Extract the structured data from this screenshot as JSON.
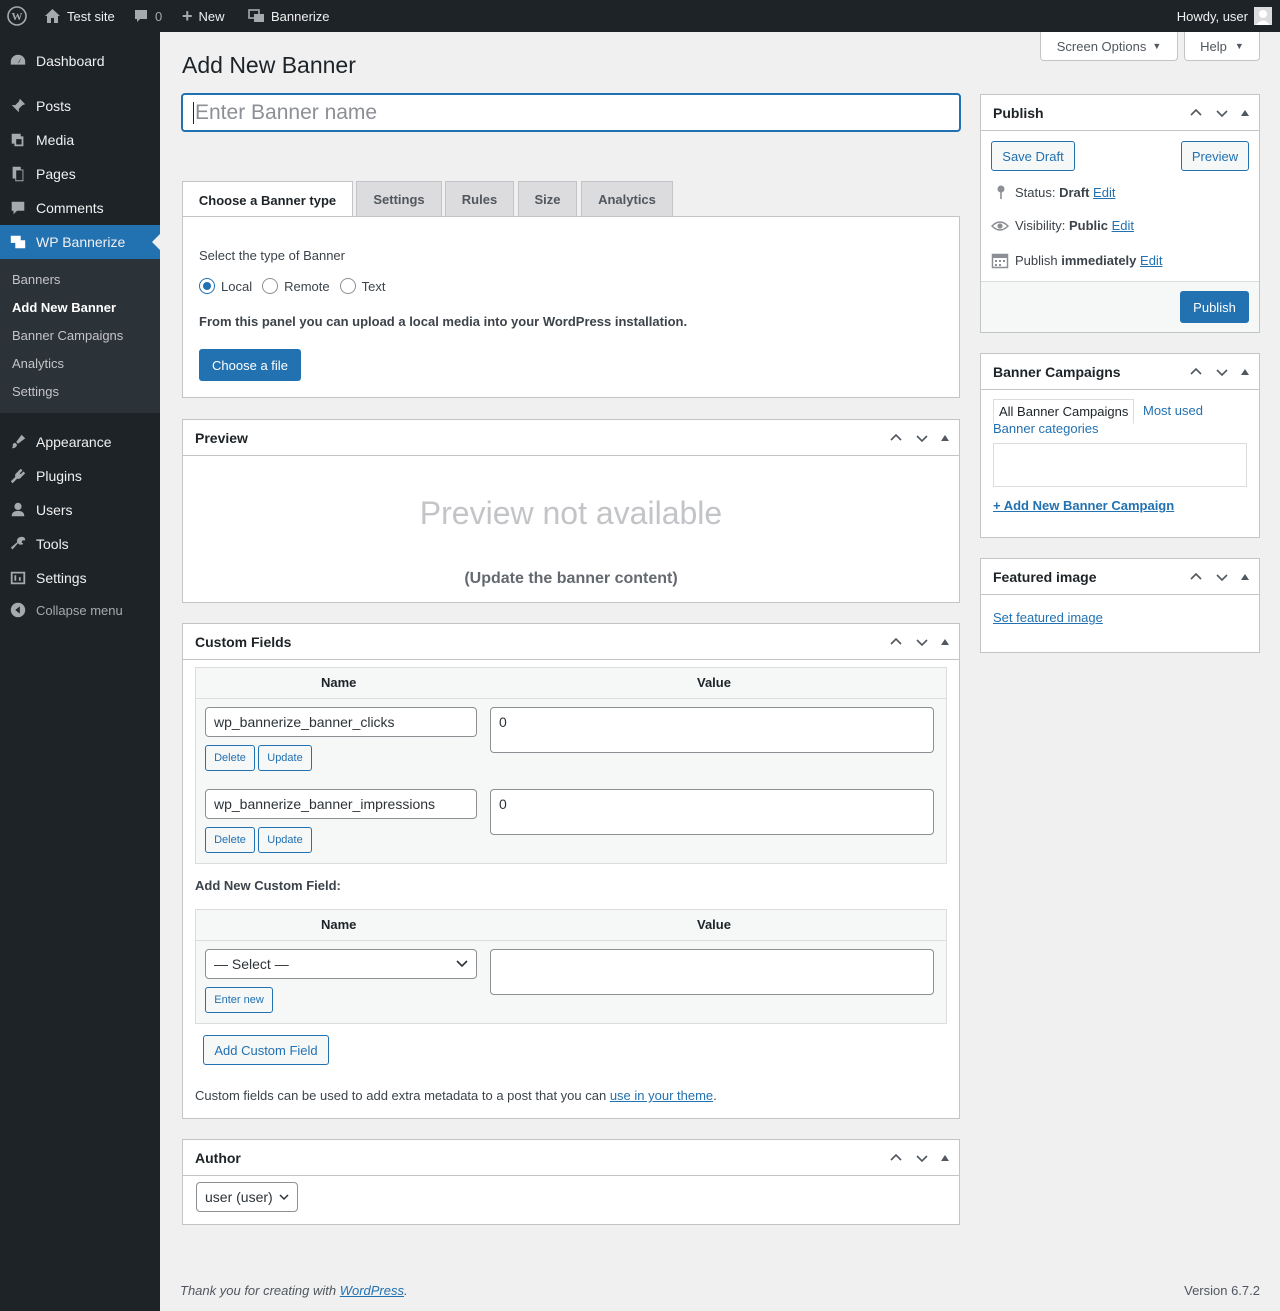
{
  "adminbar": {
    "site": "Test site",
    "comments": "0",
    "new": "New",
    "plugin": "Bannerize",
    "howdy": "Howdy, user"
  },
  "menu": {
    "items": [
      {
        "label": "Dashboard",
        "icon": "dashboard-icon"
      },
      {
        "label": "Posts",
        "icon": "pin-icon"
      },
      {
        "label": "Media",
        "icon": "media-icon"
      },
      {
        "label": "Pages",
        "icon": "pages-icon"
      },
      {
        "label": "Comments",
        "icon": "comment-icon"
      },
      {
        "label": "WP Bannerize",
        "icon": "bannerize-icon"
      },
      {
        "label": "Appearance",
        "icon": "brush-icon"
      },
      {
        "label": "Plugins",
        "icon": "plug-icon"
      },
      {
        "label": "Users",
        "icon": "user-icon"
      },
      {
        "label": "Tools",
        "icon": "wrench-icon"
      },
      {
        "label": "Settings",
        "icon": "settings-icon"
      }
    ],
    "submenu": [
      "Banners",
      "Add New Banner",
      "Banner Campaigns",
      "Analytics",
      "Settings"
    ],
    "collapse": "Collapse menu"
  },
  "top": {
    "screen_options": "Screen Options",
    "help": "Help"
  },
  "page": {
    "title": "Add New Banner",
    "name_placeholder": "Enter Banner name"
  },
  "tabs": [
    "Choose a Banner type",
    "Settings",
    "Rules",
    "Size",
    "Analytics"
  ],
  "bannertype": {
    "prompt": "Select the type of Banner",
    "options": [
      "Local",
      "Remote",
      "Text"
    ],
    "selected": "Local",
    "info": "From this panel you can upload a local media into your WordPress installation.",
    "choose_file": "Choose a file"
  },
  "preview": {
    "title": "Preview",
    "na": "Preview not available",
    "update": "(Update the banner content)"
  },
  "custom": {
    "title": "Custom Fields",
    "col_name": "Name",
    "col_value": "Value",
    "rows": [
      {
        "name": "wp_bannerize_banner_clicks",
        "value": "0"
      },
      {
        "name": "wp_bannerize_banner_impressions",
        "value": "0"
      }
    ],
    "delete": "Delete",
    "update": "Update",
    "add_new_label": "Add New Custom Field:",
    "select": "— Select —",
    "enter_new": "Enter new",
    "add_button": "Add Custom Field",
    "note_pre": "Custom fields can be used to add extra metadata to a post that you can ",
    "note_link": "use in your theme",
    "note_post": "."
  },
  "author": {
    "title": "Author",
    "value": "user (user)"
  },
  "publish": {
    "title": "Publish",
    "save_draft": "Save Draft",
    "preview": "Preview",
    "status_label": "Status: ",
    "status": "Draft",
    "visibility_label": "Visibility: ",
    "visibility": "Public",
    "publish_label": "Publish ",
    "publish_when": "immediately",
    "edit": "Edit",
    "publish_button": "Publish"
  },
  "campaigns": {
    "title": "Banner Campaigns",
    "tab_all": "All Banner Campaigns",
    "tab_most": "Most used",
    "categories": "Banner categories",
    "add": "+ Add New Banner Campaign"
  },
  "featured": {
    "title": "Featured image",
    "set": "Set featured image"
  },
  "footer": {
    "thanks": "Thank you for creating with ",
    "wp": "WordPress",
    "dot": ".",
    "version": "Version 6.7.2"
  }
}
